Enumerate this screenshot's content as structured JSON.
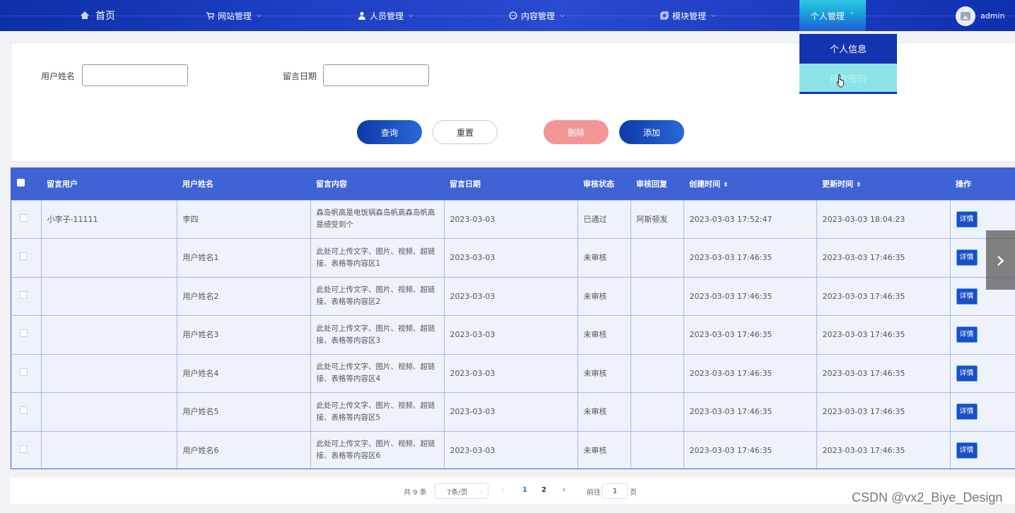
{
  "nav": {
    "home": "首页",
    "site": "网站管理",
    "people": "人员管理",
    "content": "内容管理",
    "module": "模块管理",
    "personal": "个人管理",
    "user": "admin"
  },
  "dropdown": {
    "item1": "个人信息",
    "item2": "修改密码"
  },
  "search": {
    "label_username": "用户姓名",
    "label_date": "留言日期",
    "value_username": "",
    "value_date": "",
    "btn_query": "查询",
    "btn_reset": "重置",
    "btn_delete": "删除",
    "btn_add": "添加"
  },
  "table": {
    "headers": [
      "留言用户",
      "用户姓名",
      "留言内容",
      "留言日期",
      "审核状态",
      "审核回复",
      "创建时间",
      "更新时间",
      "操作"
    ],
    "detail_label": "详情",
    "rows": [
      {
        "user": "小李子-11111",
        "name": "李四",
        "content": "森岛帆高是电饭锅森岛帆高森岛帆高是感受到个",
        "date": "2023-03-03",
        "status": "已通过",
        "reply": "阿斯顿发",
        "created": "2023-03-03 17:52:47",
        "updated": "2023-03-03 18:04:23"
      },
      {
        "user": "",
        "name": "用户姓名1",
        "content": "此处可上传文字、图片、视频、超链接、表格等内容区1",
        "date": "2023-03-03",
        "status": "未审核",
        "reply": "",
        "created": "2023-03-03 17:46:35",
        "updated": "2023-03-03 17:46:35"
      },
      {
        "user": "",
        "name": "用户姓名2",
        "content": "此处可上传文字、图片、视频、超链接、表格等内容区2",
        "date": "2023-03-03",
        "status": "未审核",
        "reply": "",
        "created": "2023-03-03 17:46:35",
        "updated": "2023-03-03 17:46:35"
      },
      {
        "user": "",
        "name": "用户姓名3",
        "content": "此处可上传文字、图片、视频、超链接、表格等内容区3",
        "date": "2023-03-03",
        "status": "未审核",
        "reply": "",
        "created": "2023-03-03 17:46:35",
        "updated": "2023-03-03 17:46:35"
      },
      {
        "user": "",
        "name": "用户姓名4",
        "content": "此处可上传文字、图片、视频、超链接、表格等内容区4",
        "date": "2023-03-03",
        "status": "未审核",
        "reply": "",
        "created": "2023-03-03 17:46:35",
        "updated": "2023-03-03 17:46:35"
      },
      {
        "user": "",
        "name": "用户姓名5",
        "content": "此处可上传文字、图片、视频、超链接、表格等内容区5",
        "date": "2023-03-03",
        "status": "未审核",
        "reply": "",
        "created": "2023-03-03 17:46:35",
        "updated": "2023-03-03 17:46:35"
      },
      {
        "user": "",
        "name": "用户姓名6",
        "content": "此处可上传文字、图片、视频、超链接、表格等内容区6",
        "date": "2023-03-03",
        "status": "未审核",
        "reply": "",
        "created": "2023-03-03 17:46:35",
        "updated": "2023-03-03 17:46:35"
      }
    ]
  },
  "pager": {
    "total": "共 9 条",
    "page_size": "7条/页",
    "prev": "‹",
    "page1": "1",
    "page2": "2",
    "next": "›",
    "goto_label": "前往",
    "goto_value": "1",
    "page_unit": "页"
  },
  "watermark": "CSDN @vx2_Biye_Design",
  "colors": {
    "nav_bg": "#1d3fc4",
    "accent": "#3f63d4",
    "active_tab": "#2ec8e8",
    "delete": "#f29595"
  }
}
